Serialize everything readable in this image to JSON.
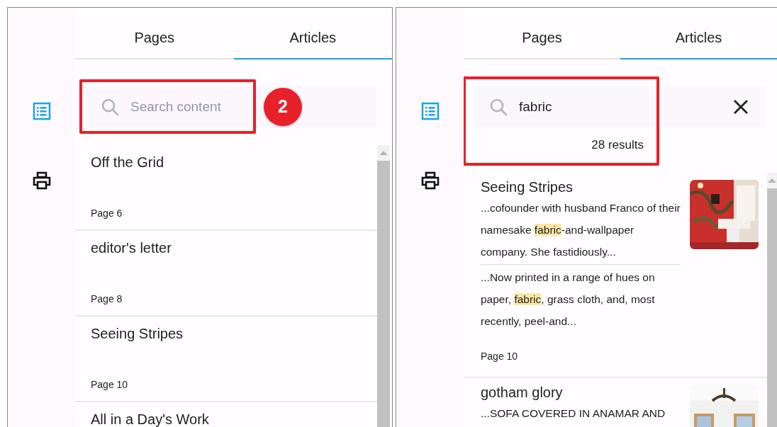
{
  "panels": [
    {
      "rail": [
        {
          "kind": "list",
          "selected": true
        },
        {
          "kind": "print",
          "selected": false
        }
      ],
      "tabs": [
        {
          "label": "Pages",
          "selected": false
        },
        {
          "label": "Articles",
          "selected": true
        }
      ],
      "search": {
        "placeholder": "Search content",
        "highlighted": true,
        "badge": "2"
      },
      "articles": [
        {
          "title": "Off the Grid",
          "page": "Page 6"
        },
        {
          "title": "editor's letter",
          "page": "Page 8"
        },
        {
          "title": "Seeing Stripes",
          "page": "Page 10"
        },
        {
          "title": "All in a Day's Work"
        }
      ]
    },
    {
      "rail": [
        {
          "kind": "list",
          "selected": true
        },
        {
          "kind": "print",
          "selected": false
        }
      ],
      "tabs": [
        {
          "label": "Pages",
          "selected": false
        },
        {
          "label": "Articles",
          "selected": true
        }
      ],
      "search": {
        "value": "fabric",
        "highlighted": true,
        "results": "28 results"
      },
      "articles": [
        {
          "title": "Seeing Stripes",
          "thumbnail": {
            "kind": "picture"
          },
          "snippets": [
            {
              "before": "...cofounder with husband Franco of their namesake ",
              "match": "fabric",
              "after": "-and-wallpaper company. She fastidiously..."
            },
            {
              "before": "...Now printed in a range of hues on paper, ",
              "match": "fabric",
              "after": ", grass cloth, and, most recently, peel-and..."
            }
          ],
          "page": "Page 10"
        },
        {
          "title": "gotham glory",
          "thumbnail": {
            "kind": "picture"
          },
          "snippets": [
            {
              "before": "...SOFA COVERED IN ANAMAR AND"
            }
          ]
        }
      ]
    }
  ]
}
